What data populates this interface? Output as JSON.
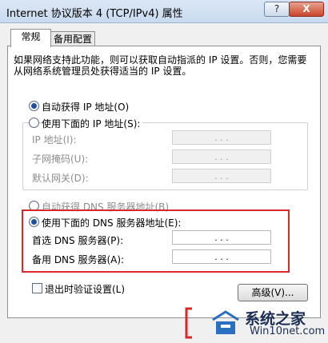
{
  "window": {
    "title": "Internet 协议版本 4 (TCP/IPv4) 属性",
    "help_label": "?",
    "close_label": "X"
  },
  "tabs": [
    {
      "label": "常规",
      "active": true
    },
    {
      "label": "备用配置",
      "active": false
    }
  ],
  "description": "如果网络支持此功能，则可以获取自动指派的 IP 设置。否则，您需要从网络系统管理员处获得适当的 IP 设置。",
  "ip_section": {
    "auto_label": "自动获得 IP 地址(O)",
    "manual_label": "使用下面的 IP 地址(S):",
    "fields": [
      {
        "label": "IP 地址(I):",
        "value": ".   .   ."
      },
      {
        "label": "子网掩码(U):",
        "value": ".   .   ."
      },
      {
        "label": "默认网关(D):",
        "value": ".   .   ."
      }
    ]
  },
  "dns_section": {
    "auto_label": "自动获得 DNS 服务器地址(B)",
    "manual_label": "使用下面的 DNS 服务器地址(E):",
    "fields": [
      {
        "label": "首选 DNS 服务器(P):",
        "value": ".   .   ."
      },
      {
        "label": "备用 DNS 服务器(A):",
        "value": ".   .   ."
      }
    ]
  },
  "validate_label": "退出时验证设置(L)",
  "advanced_label": "高级(V)...",
  "watermark": {
    "brand": "系统之家",
    "site": "Win10net.com"
  },
  "colors": {
    "highlight_box": "#d9282a",
    "radio_dot": "#1c4f9c"
  }
}
